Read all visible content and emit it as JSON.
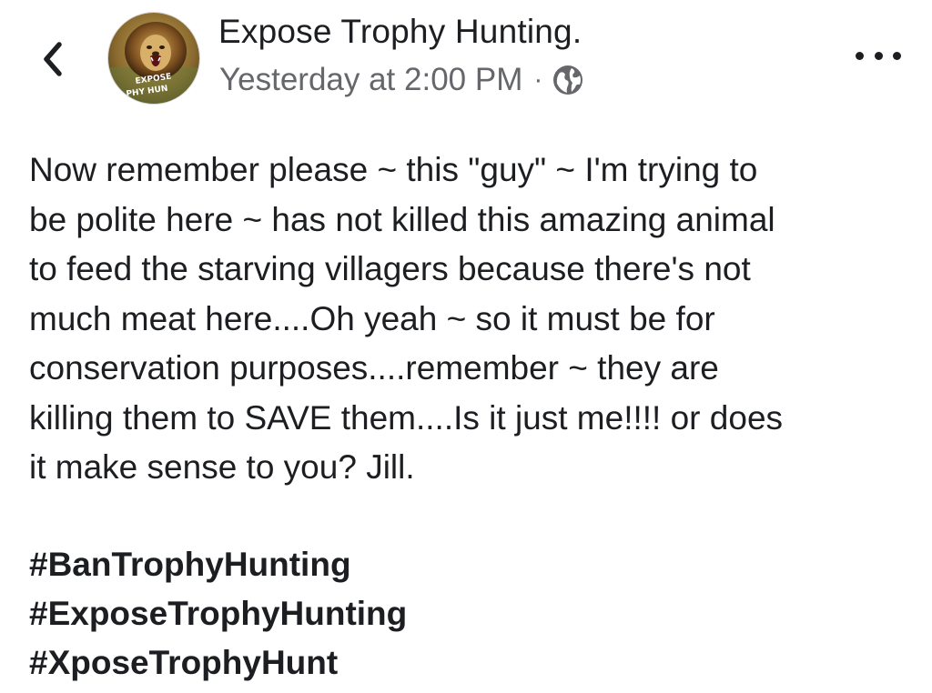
{
  "header": {
    "back_icon": "chevron-left-icon",
    "author_name": "Expose Trophy Hunting.",
    "timestamp": "Yesterday at 2:00 PM",
    "separator": "·",
    "privacy_icon": "globe-icon",
    "more_icon": "more-horizontal-icon",
    "avatar_text_top": "EXPOSE",
    "avatar_text_bottom": "PHY HUN"
  },
  "post": {
    "lines": [
      "Now remember please ~ this \"guy\" ~ I'm trying to",
      "be polite here ~ has not killed this amazing animal",
      "to feed the starving villagers because there's not",
      "much meat here....Oh yeah ~ so it must be for",
      "conservation purposes....remember ~ they are",
      "killing them to SAVE them....Is it just me!!!! or does",
      "it make sense to you? Jill."
    ],
    "hashtags": [
      "#BanTrophyHunting",
      "#ExposeTrophyHunting",
      "#XposeTrophyHunt"
    ]
  },
  "colors": {
    "text": "#1c1e21",
    "secondary_text": "#65676b",
    "background": "#ffffff"
  }
}
